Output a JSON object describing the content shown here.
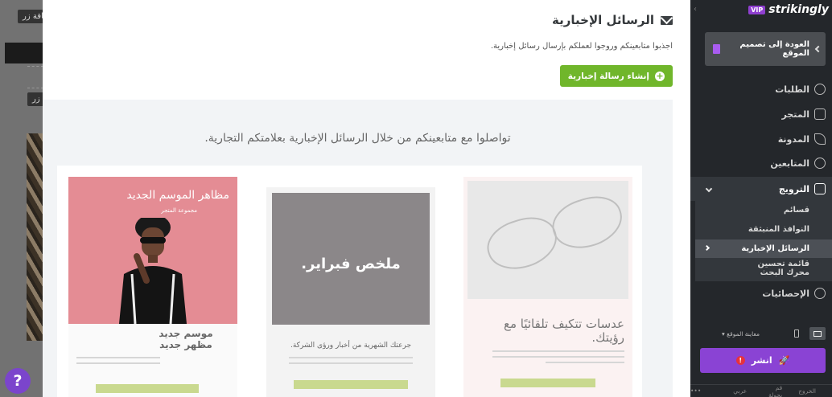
{
  "backdrop": {
    "chip_top": "إضافة زر",
    "chip_mid": "زر"
  },
  "help": {
    "label": "?"
  },
  "modal": {
    "title": "الرسائل الإخبارية",
    "description": "اجذبوا متابعينكم وروجوا لعملكم بإرسال رسائل إخبارية.",
    "create_button": "إنشاء رسالة إخبارية",
    "panel_heading": "تواصلوا مع متابعينكم من خلال الرسائل الإخبارية بعلامتكم التجارية.",
    "cards": [
      {
        "title": "عدسات تتكيف تلقائيًا مع رؤيتك."
      },
      {
        "image_text": "ملخص فبراير.",
        "title": "جرعتك الشهرية من أخبار ورؤى الشركة."
      },
      {
        "image_title": "مظاهر الموسم الجديد",
        "image_sub": "مجموعة المتجر",
        "title": "موسم جديد مظهر جديد"
      }
    ]
  },
  "sidebar": {
    "brand": "strikingly",
    "badge": "VIP",
    "back_label": "العودة إلى تصميم الموقع",
    "nav": {
      "orders": "الطلبات",
      "store": "المتجر",
      "blog": "المدونة",
      "followers": "المتابعين",
      "promotion": "الترويج",
      "stats": "الإحصائيات"
    },
    "promotion_sub": {
      "coupons": "قسائم",
      "popups": "النوافذ المنبثقة",
      "newsletters": "الرسائل الإخبارية",
      "seo": "قائمة تحسين محرك البحث"
    },
    "preview_label": "معاينة الموقع",
    "publish_label": "انشر",
    "footer": {
      "exit": "الخروج",
      "save": "قم بجولة",
      "language": "عربي",
      "more": "•••"
    }
  }
}
